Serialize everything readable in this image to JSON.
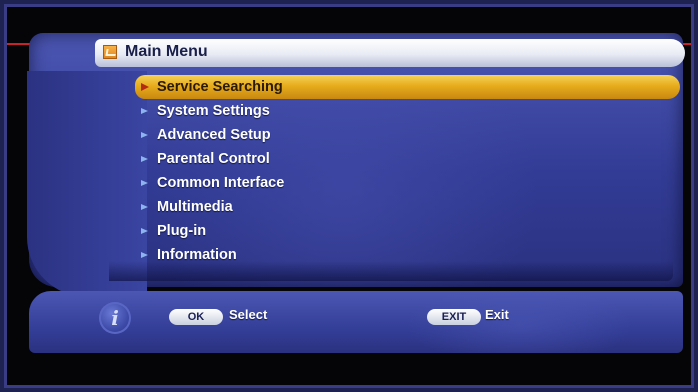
{
  "header": {
    "title": "Main Menu",
    "icon": "menu-folder-icon"
  },
  "menu": {
    "selected_index": 0,
    "items": [
      {
        "label": "Service Searching"
      },
      {
        "label": "System Settings"
      },
      {
        "label": "Advanced Setup"
      },
      {
        "label": "Parental Control"
      },
      {
        "label": "Common Interface"
      },
      {
        "label": "Multimedia"
      },
      {
        "label": "Plug-in"
      },
      {
        "label": "Information"
      }
    ]
  },
  "footer": {
    "info_glyph": "i",
    "ok": {
      "key": "OK",
      "label": "Select"
    },
    "exit": {
      "key": "EXIT",
      "label": "Exit"
    }
  },
  "colors": {
    "panel": "#3a45a2",
    "highlight": "#e7ac1c",
    "title_bar": "#e8ebf4",
    "border": "#3a3d86"
  }
}
